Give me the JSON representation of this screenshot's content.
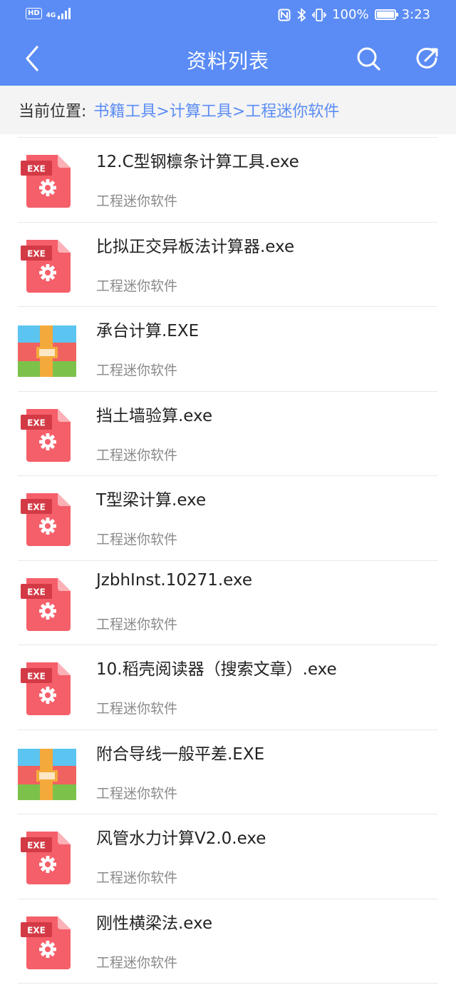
{
  "status_bar": {
    "hd": "HD",
    "network": "4G",
    "battery": "100%",
    "time": "3:23"
  },
  "header": {
    "title": "资料列表",
    "back_icon": "chevron-left-icon",
    "search_icon": "search-icon",
    "share_icon": "share-icon"
  },
  "breadcrumb": {
    "label": "当前位置:",
    "path": "书籍工具>计算工具>工程迷你软件"
  },
  "colors": {
    "primary": "#5b8cf5",
    "exe_red": "#f55f6a",
    "exe_dark_red": "#d33a45"
  },
  "files": [
    {
      "name": "12.C型钢檩条计算工具.exe",
      "category": "工程迷你软件",
      "icon": "exe-file-icon"
    },
    {
      "name": "比拟正交异板法计算器.exe",
      "category": "工程迷你软件",
      "icon": "exe-file-icon"
    },
    {
      "name": "承台计算.EXE",
      "category": "工程迷你软件",
      "icon": "archive-icon"
    },
    {
      "name": "挡土墙验算.exe",
      "category": "工程迷你软件",
      "icon": "exe-file-icon"
    },
    {
      "name": "T型梁计算.exe",
      "category": "工程迷你软件",
      "icon": "exe-file-icon"
    },
    {
      "name": "JzbhInst.10271.exe",
      "category": "工程迷你软件",
      "icon": "exe-file-icon"
    },
    {
      "name": "10.稻壳阅读器（搜索文章）.exe",
      "category": "工程迷你软件",
      "icon": "exe-file-icon"
    },
    {
      "name": "附合导线一般平差.EXE",
      "category": "工程迷你软件",
      "icon": "archive-icon"
    },
    {
      "name": "风管水力计算V2.0.exe",
      "category": "工程迷你软件",
      "icon": "exe-file-icon"
    },
    {
      "name": "刚性横梁法.exe",
      "category": "工程迷你软件",
      "icon": "exe-file-icon"
    }
  ],
  "exe_badge": "EXE"
}
